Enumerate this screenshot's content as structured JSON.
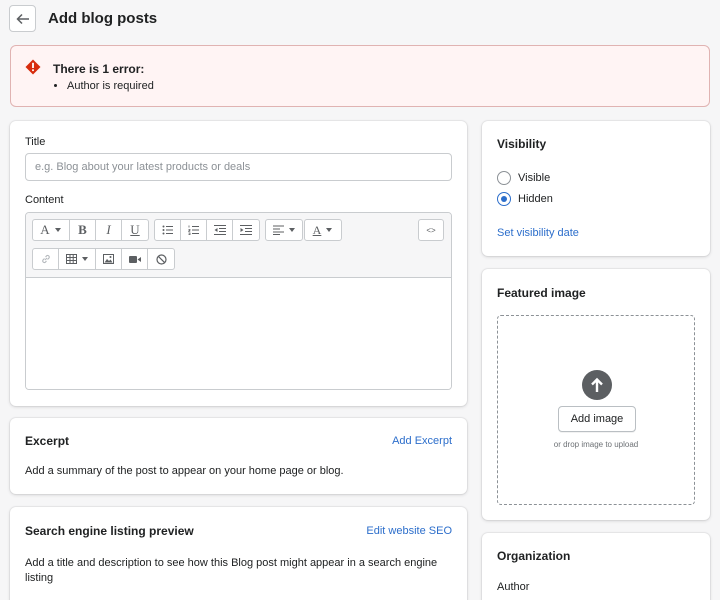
{
  "header": {
    "back_icon": "arrow-left-icon",
    "title": "Add blog posts"
  },
  "error": {
    "title": "There is 1 error:",
    "items": [
      "Author is required"
    ],
    "color": "#d72c0d",
    "background": "#fff4f4"
  },
  "main": {
    "title_label": "Title",
    "title_placeholder": "e.g. Blog about your latest products or deals",
    "content_label": "Content",
    "toolbar": {
      "row1": [
        "font-style-dropdown",
        "bold",
        "italic",
        "underline",
        "bulleted-list",
        "numbered-list",
        "outdent",
        "indent",
        "align-dropdown",
        "text-color-dropdown",
        "show-html"
      ],
      "row2": [
        "insert-link",
        "insert-table-dropdown",
        "insert-image",
        "insert-video",
        "clear-formatting"
      ]
    }
  },
  "excerpt": {
    "title": "Excerpt",
    "action": "Add Excerpt",
    "description": "Add a summary of the post to appear on your home page or blog."
  },
  "seo": {
    "title": "Search engine listing preview",
    "action": "Edit website SEO",
    "description": "Add a title and description to see how this Blog post might appear in a search engine listing"
  },
  "visibility": {
    "title": "Visibility",
    "options": [
      {
        "label": "Visible",
        "checked": false
      },
      {
        "label": "Hidden",
        "checked": true
      }
    ],
    "action": "Set visibility date"
  },
  "featured_image": {
    "title": "Featured image",
    "upload_icon": "arrow-up-circle-icon",
    "button": "Add image",
    "hint": "or drop image to upload"
  },
  "organization": {
    "title": "Organization",
    "author_label": "Author"
  },
  "colors": {
    "accent": "#2c6ecb",
    "text": "#202223",
    "subdued": "#6d7175",
    "border": "#c9cccf"
  }
}
